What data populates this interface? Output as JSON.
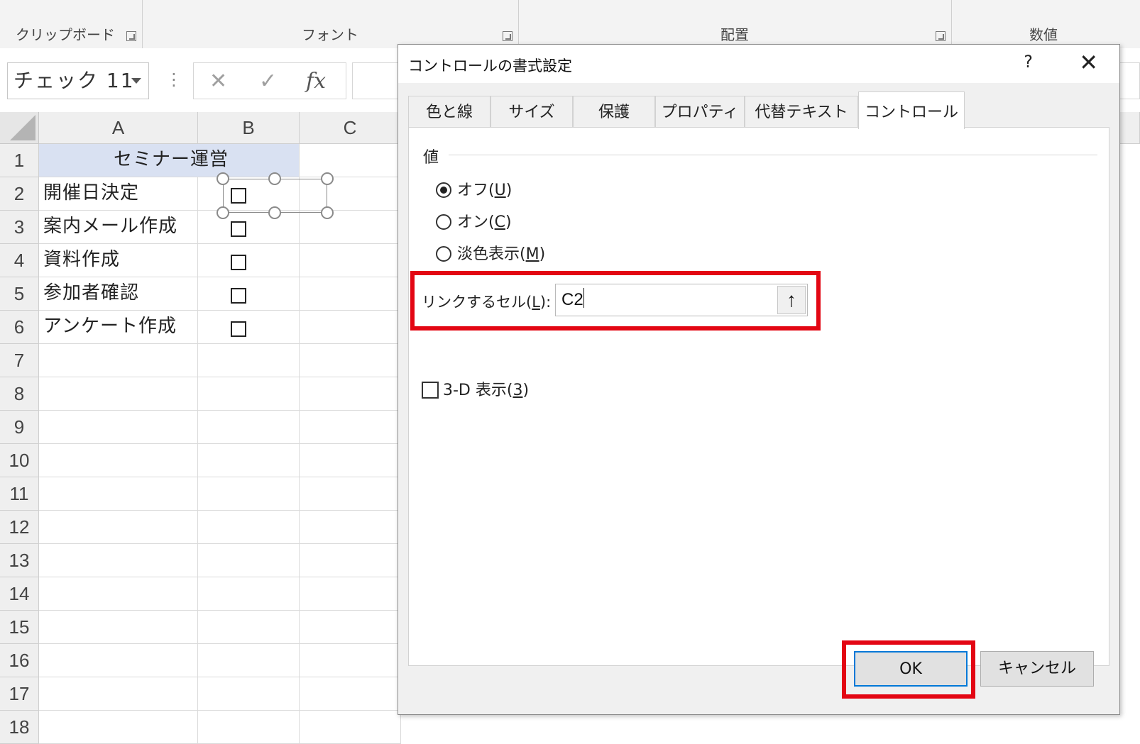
{
  "ribbon": {
    "groups": [
      "クリップボード",
      "フォント",
      "配置",
      "数値"
    ]
  },
  "formula_bar": {
    "name_box": "チェック 11",
    "cancel_icon": "✕",
    "enter_icon": "✓",
    "fx_label": "fx",
    "formula": ""
  },
  "sheet": {
    "columns": [
      "A",
      "B",
      "C"
    ],
    "rows": [
      "1",
      "2",
      "3",
      "4",
      "5",
      "6",
      "7",
      "8",
      "9",
      "10",
      "11",
      "12",
      "13",
      "14",
      "15",
      "16",
      "17",
      "18"
    ],
    "a1": "セミナー運営",
    "tasks": [
      "開催日決定",
      "案内メール作成",
      "資料作成",
      "参加者確認",
      "アンケート作成"
    ]
  },
  "dialog": {
    "title": "コントロールの書式設定",
    "help": "?",
    "close": "✕",
    "tabs": [
      "色と線",
      "サイズ",
      "保護",
      "プロパティ",
      "代替テキスト",
      "コントロール"
    ],
    "active_tab": "コントロール",
    "value_section": "値",
    "radios": [
      {
        "label": "オフ(",
        "key": "U",
        "end": ")",
        "checked": true
      },
      {
        "label": "オン(",
        "key": "C",
        "end": ")",
        "checked": false
      },
      {
        "label": "淡色表示(",
        "key": "M",
        "end": ")",
        "checked": false
      }
    ],
    "link_label_pre": "リンクするセル(",
    "link_label_key": "L",
    "link_label_post": "):",
    "link_value": "C2",
    "collapse_icon": "🡅",
    "three_d_pre": "3-D 表示(",
    "three_d_key": "3",
    "three_d_post": ")",
    "three_d_checked": false,
    "ok": "OK",
    "cancel": "キャンセル"
  },
  "highlight_color": "#e30613"
}
